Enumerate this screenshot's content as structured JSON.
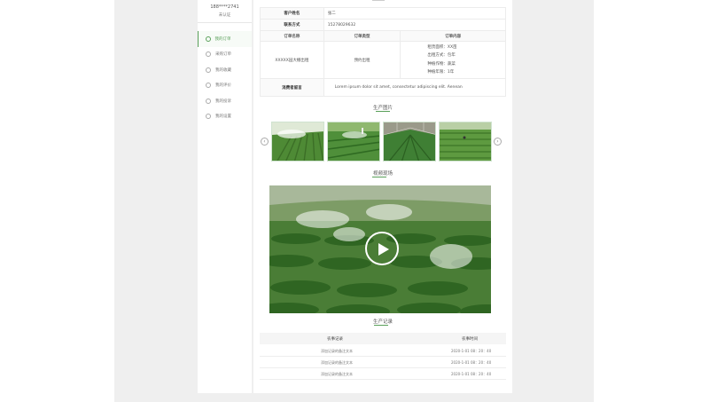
{
  "sidebar": {
    "phone": "188****2741",
    "verify_status": "未认证",
    "items": [
      {
        "label": "我的订单",
        "icon": "order-icon",
        "active": true
      },
      {
        "label": "采购订单",
        "icon": "cart-icon",
        "active": false
      },
      {
        "label": "我的收藏",
        "icon": "heart-icon",
        "active": false
      },
      {
        "label": "我的评价",
        "icon": "comment-icon",
        "active": false
      },
      {
        "label": "我的投诉",
        "icon": "complaint-icon",
        "active": false
      },
      {
        "label": "我的设置",
        "icon": "gear-icon",
        "active": false
      }
    ]
  },
  "info": {
    "customer_label": "客户姓名",
    "customer_value": "张二",
    "contact_label": "联系方式",
    "contact_value": "15278029632",
    "col_name": "订单名称",
    "col_type": "订单类型",
    "col_content": "订单内容",
    "order_name": "XXXXX园大棚出租",
    "order_type": "预约出租",
    "order_details": [
      "租赁面积：XX亩",
      "出租方式：包年",
      "种植作物：蔬菜",
      "种植年限：1年"
    ],
    "remark_label": "消费者留言",
    "remark_value": "Lorem ipsum dolor sit amet, consectetur adipiscing elit. Aenean"
  },
  "sections": {
    "photos_title": "生产图片",
    "video_title": "视频现场",
    "records_title": "生产记录"
  },
  "records": {
    "header_left": "农事记录",
    "header_right": "农事时间",
    "rows": [
      {
        "text": "添加记录的备注文本",
        "time": "2020-1-01  08：20：40"
      },
      {
        "text": "添加记录的备注文本",
        "time": "2020-1-01  08：20：40"
      },
      {
        "text": "添加记录的备注文本",
        "time": "2020-1-01  08：20：40"
      }
    ]
  },
  "colors": {
    "accent": "#5aa05a",
    "page_bg": "#efefef"
  },
  "icons": {
    "prev": "chevron-left-icon",
    "next": "chevron-right-icon",
    "play": "play-icon"
  }
}
